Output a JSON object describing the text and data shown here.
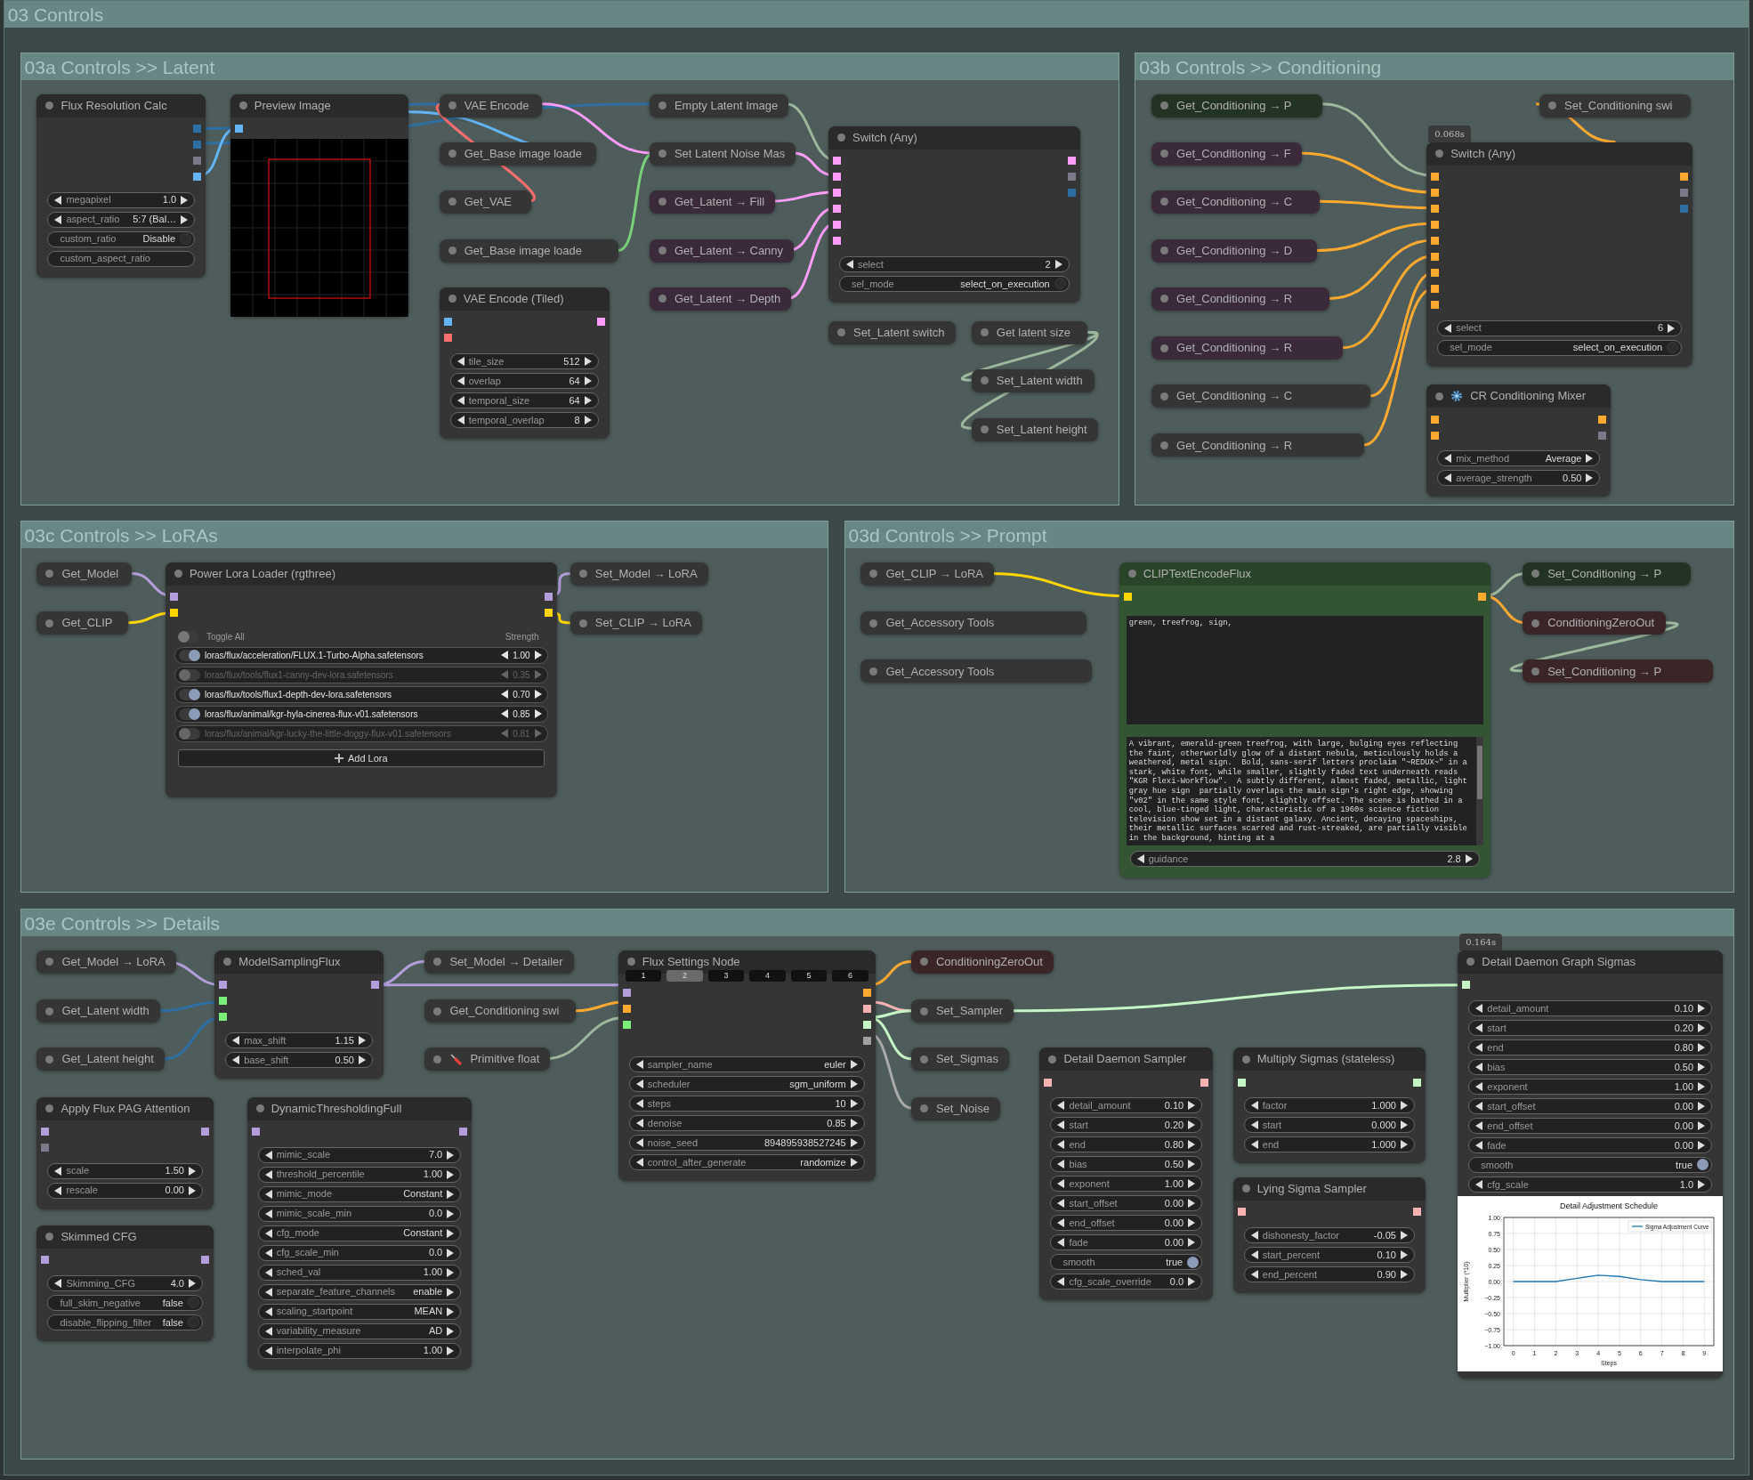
{
  "canvas": {
    "title": "03 Controls"
  },
  "groups": [
    {
      "title": "03a Controls >> Latent",
      "nodes": [
        {
          "title": "Flux Resolution Calc",
          "kind": "node",
          "color": "#353535",
          "outputs": [
            {
              "color": "#2d6ea3"
            },
            {
              "color": "#2d6ea3"
            },
            {
              "color": "#7a7a8a"
            },
            {
              "color": "#64b5f6"
            }
          ],
          "widgets": [
            {
              "kind": "number",
              "label": "megapixel",
              "value": "1.0"
            },
            {
              "kind": "number",
              "label": "aspect_ratio",
              "value": "5:7 (Bal…"
            },
            {
              "kind": "toggle",
              "label": "custom_ratio",
              "value": "Disable",
              "on": false
            },
            {
              "kind": "text",
              "label": "custom_aspect_ratio"
            }
          ]
        },
        {
          "title": "Preview Image",
          "kind": "preview",
          "color": "#353535",
          "inputs": [
            {
              "color": "#64b5f6"
            }
          ]
        },
        {
          "title": "VAE Encode",
          "kind": "collapsed",
          "color": "#353535"
        },
        {
          "title": "Get_Base image loade",
          "kind": "collapsed",
          "color": "#353535"
        },
        {
          "title": "Get_VAE",
          "kind": "collapsed",
          "color": "#353535"
        },
        {
          "title": "Get_Base image loade",
          "kind": "collapsed",
          "color": "#353535"
        },
        {
          "title": "VAE Encode (Tiled)",
          "kind": "node",
          "color": "#353535",
          "inputs": [
            {
              "color": "#64b5f6"
            },
            {
              "color": "#ff6e6e"
            }
          ],
          "outputs": [
            {
              "color": "#ff9cf9"
            }
          ],
          "widgets": [
            {
              "kind": "number",
              "label": "tile_size",
              "value": "512"
            },
            {
              "kind": "number",
              "label": "overlap",
              "value": "64"
            },
            {
              "kind": "number",
              "label": "temporal_size",
              "value": "64"
            },
            {
              "kind": "number",
              "label": "temporal_overlap",
              "value": "8"
            }
          ]
        },
        {
          "title": "Empty Latent Image",
          "kind": "collapsed",
          "color": "#353535"
        },
        {
          "title": "Set Latent Noise Mas",
          "kind": "collapsed",
          "color": "#353535"
        },
        {
          "title": "Get_Latent → Fill",
          "kind": "collapsed",
          "color": "#3a2a3a"
        },
        {
          "title": "Get_Latent → Canny",
          "kind": "collapsed",
          "color": "#3a2a3a"
        },
        {
          "title": "Get_Latent → Depth",
          "kind": "collapsed",
          "color": "#3a2a3a"
        },
        {
          "title": "Switch (Any)",
          "kind": "node",
          "color": "#353535",
          "inputs": [
            {
              "color": "#ff9cf9"
            },
            {
              "color": "#ff9cf9"
            },
            {
              "color": "#ff9cf9"
            },
            {
              "color": "#ff9cf9"
            },
            {
              "color": "#ff9cf9"
            },
            {
              "color": "#ff9cf9"
            }
          ],
          "outputs": [
            {
              "color": "#ff9cf9"
            },
            {
              "color": "#7a7a8a"
            },
            {
              "color": "#2d6ea3"
            }
          ],
          "widgets": [
            {
              "kind": "number",
              "label": "select",
              "value": "2"
            },
            {
              "kind": "toggle",
              "label": "sel_mode",
              "value": "select_on_execution",
              "on": false
            }
          ]
        },
        {
          "title": "Set_Latent switch",
          "kind": "collapsed",
          "color": "#353535"
        },
        {
          "title": "Get latent size",
          "kind": "collapsed",
          "color": "#353535"
        },
        {
          "title": "Set_Latent width",
          "kind": "collapsed",
          "color": "#353535"
        },
        {
          "title": "Set_Latent height",
          "kind": "collapsed",
          "color": "#353535"
        }
      ]
    },
    {
      "title": "03b Controls >> Conditioning",
      "nodes": [
        {
          "title": "Get_Conditioning → P",
          "kind": "collapsed",
          "color": "#233323"
        },
        {
          "title": "Get_Conditioning → F",
          "kind": "collapsed",
          "color": "#3a2a3a"
        },
        {
          "title": "Get_Conditioning → C",
          "kind": "collapsed",
          "color": "#3a2a3a"
        },
        {
          "title": "Get_Conditioning → D",
          "kind": "collapsed",
          "color": "#3a2a3a"
        },
        {
          "title": "Get_Conditioning → R",
          "kind": "collapsed",
          "color": "#3a2a3a"
        },
        {
          "title": "Get_Conditioning → R",
          "kind": "collapsed",
          "color": "#3a2a3a"
        },
        {
          "title": "Get_Conditioning → C",
          "kind": "collapsed",
          "color": "#353535"
        },
        {
          "title": "Get_Conditioning → R",
          "kind": "collapsed",
          "color": "#353535"
        },
        {
          "title": "Set_Conditioning swi",
          "kind": "collapsed",
          "color": "#353535"
        },
        {
          "title": "Switch (Any)",
          "kind": "node",
          "color": "#353535",
          "badge": "0.068s",
          "inputs": [
            {
              "color": "#ffa931"
            },
            {
              "color": "#ffa931"
            },
            {
              "color": "#ffa931"
            },
            {
              "color": "#ffa931"
            },
            {
              "color": "#ffa931"
            },
            {
              "color": "#ffa931"
            },
            {
              "color": "#ffa931"
            },
            {
              "color": "#ffa931"
            },
            {
              "color": "#ffa931"
            }
          ],
          "outputs": [
            {
              "color": "#ffa931"
            },
            {
              "color": "#7a7a8a"
            },
            {
              "color": "#2d6ea3"
            }
          ],
          "widgets": [
            {
              "kind": "number",
              "label": "select",
              "value": "6"
            },
            {
              "kind": "toggle",
              "label": "sel_mode",
              "value": "select_on_execution",
              "on": false
            }
          ]
        },
        {
          "title": "CR Conditioning Mixer",
          "kind": "node",
          "color": "#353535",
          "inputs": [
            {
              "color": "#ffa931"
            },
            {
              "color": "#ffa931"
            }
          ],
          "outputs": [
            {
              "color": "#ffa931"
            },
            {
              "color": "#7a7a8a"
            }
          ],
          "widgets": [
            {
              "kind": "number",
              "label": "mix_method",
              "value": "Average"
            },
            {
              "kind": "number",
              "label": "average_strength",
              "value": "0.50"
            }
          ]
        }
      ]
    },
    {
      "title": "03c Controls >> LoRAs",
      "nodes": [
        {
          "title": "Get_Model",
          "kind": "collapsed",
          "color": "#353535"
        },
        {
          "title": "Get_CLIP",
          "kind": "collapsed",
          "color": "#353535"
        },
        {
          "title": "Power Lora Loader (rgthree)",
          "kind": "node",
          "color": "#353535",
          "inputs": [
            {
              "color": "#b39ddb"
            },
            {
              "color": "#ffd500"
            }
          ],
          "outputs": [
            {
              "color": "#b39ddb"
            },
            {
              "color": "#ffd500"
            }
          ],
          "toggle_all": {
            "label": "Toggle All",
            "on": false
          },
          "strength_label": "Strength",
          "loras": [
            {
              "name": "loras/flux/acceleration/FLUX.1-Turbo-Alpha.safetensors",
              "strength": "1.00",
              "on": true
            },
            {
              "name": "loras/flux/tools/flux1-canny-dev-lora.safetensors",
              "strength": "0.35",
              "on": false
            },
            {
              "name": "loras/flux/tools/flux1-depth-dev-lora.safetensors",
              "strength": "0.70",
              "on": true
            },
            {
              "name": "loras/flux/animal/kgr-hyla-cinerea-flux-v01.safetensors",
              "strength": "0.85",
              "on": true
            },
            {
              "name": "loras/flux/animal/kgr-lucky-the-little-doggy-flux-v01.safetensors",
              "strength": "0.81",
              "on": false
            }
          ],
          "add_button": "Add Lora"
        },
        {
          "title": "Set_Model → LoRA",
          "kind": "collapsed",
          "color": "#353535"
        },
        {
          "title": "Set_CLIP → LoRA",
          "kind": "collapsed",
          "color": "#353535"
        }
      ]
    },
    {
      "title": "03d Controls >> Prompt",
      "nodes": [
        {
          "title": "Get_CLIP → LoRA",
          "kind": "collapsed",
          "color": "#353535"
        },
        {
          "title": "Get_Accessory Tools",
          "kind": "collapsed",
          "color": "#353535"
        },
        {
          "title": "Get_Accessory Tools",
          "kind": "collapsed",
          "color": "#353535"
        },
        {
          "title": "CLIPTextEncodeFlux",
          "kind": "node",
          "color": "#335533",
          "inputs": [
            {
              "color": "#ffd500"
            }
          ],
          "outputs": [
            {
              "color": "#ffa931"
            }
          ],
          "textareas": [
            "green, treefrog, sign,",
            "A vibrant, emerald-green treefrog, with large, bulging eyes reflecting the faint, otherworldly glow of a distant nebula, meticulously holds a weathered, metal sign.  Bold, sans-serif letters proclaim \"~REDUX~\" in a stark, white font, while smaller, slightly faded text underneath reads \"KGR Flexi-Workflow\".  A subtly different, almost faded, metallic, light gray hue sign  partially overlaps the main sign's right edge, showing \"v02\" in the same style font, slightly offset. The scene is bathed in a cool, blue-tinged light, characteristic of a 1960s science fiction television show set in a distant galaxy. Ancient, decaying spaceships, their metallic surfaces scarred and rust-streaked, are partially visible in the background, hinting at a"
          ],
          "widgets": [
            {
              "kind": "number",
              "label": "guidance",
              "value": "2.8"
            }
          ]
        },
        {
          "title": "Set_Conditioning → P",
          "kind": "collapsed",
          "color": "#233323"
        },
        {
          "title": "ConditioningZeroOut",
          "kind": "collapsed",
          "color": "#3a2626"
        },
        {
          "title": "Set_Conditioning → P",
          "kind": "collapsed",
          "color": "#3a2626"
        }
      ]
    },
    {
      "title": "03e Controls >> Details",
      "nodes": [
        {
          "title": "Get_Model → LoRA",
          "kind": "collapsed",
          "color": "#353535"
        },
        {
          "title": "ModelSamplingFlux",
          "kind": "node",
          "color": "#353535",
          "inputs": [
            {
              "color": "#b39ddb"
            },
            {
              "color": "#7bed7b"
            },
            {
              "color": "#7bed7b"
            }
          ],
          "outputs": [
            {
              "color": "#b39ddb"
            }
          ],
          "widgets": [
            {
              "kind": "number",
              "label": "max_shift",
              "value": "1.15"
            },
            {
              "kind": "number",
              "label": "base_shift",
              "value": "0.50"
            }
          ]
        },
        {
          "title": "Set_Model → Detailer",
          "kind": "collapsed",
          "color": "#353535"
        },
        {
          "title": "Flux Settings Node",
          "kind": "node",
          "color": "#353535",
          "tabs": [
            {
              "label": "1",
              "selected": false
            },
            {
              "label": "2",
              "selected": true
            },
            {
              "label": "3",
              "selected": false
            },
            {
              "label": "4",
              "selected": false
            },
            {
              "label": "5",
              "selected": false
            },
            {
              "label": "6",
              "selected": false
            }
          ],
          "inputs": [
            {
              "color": "#b39ddb"
            },
            {
              "color": "#ffa931"
            },
            {
              "color": "#7bed7b"
            }
          ],
          "outputs": [
            {
              "color": "#ffa931"
            },
            {
              "color": "#f5b2b2"
            },
            {
              "color": "#c5f5c5"
            },
            {
              "color": "#a0a0a0"
            }
          ],
          "widgets": [
            {
              "kind": "number",
              "label": "sampler_name",
              "value": "euler"
            },
            {
              "kind": "number",
              "label": "scheduler",
              "value": "sgm_uniform"
            },
            {
              "kind": "number",
              "label": "steps",
              "value": "10"
            },
            {
              "kind": "number",
              "label": "denoise",
              "value": "0.85"
            },
            {
              "kind": "number",
              "label": "noise_seed",
              "value": "894895938527245"
            },
            {
              "kind": "number",
              "label": "control_after_generate",
              "value": "randomize"
            }
          ]
        },
        {
          "title": "ConditioningZeroOut",
          "kind": "collapsed",
          "color": "#3a2626"
        },
        {
          "title": "Detail Daemon Graph Sigmas",
          "kind": "node",
          "color": "#353535",
          "badge": "0.164s",
          "inputs": [
            {
              "color": "#c5f5c5"
            }
          ],
          "widgets": [
            {
              "kind": "number",
              "label": "detail_amount",
              "value": "0.10"
            },
            {
              "kind": "number",
              "label": "start",
              "value": "0.20"
            },
            {
              "kind": "number",
              "label": "end",
              "value": "0.80"
            },
            {
              "kind": "number",
              "label": "bias",
              "value": "0.50"
            },
            {
              "kind": "number",
              "label": "exponent",
              "value": "1.00"
            },
            {
              "kind": "number",
              "label": "start_offset",
              "value": "0.00"
            },
            {
              "kind": "number",
              "label": "end_offset",
              "value": "0.00"
            },
            {
              "kind": "number",
              "label": "fade",
              "value": "0.00"
            },
            {
              "kind": "toggle",
              "label": "smooth",
              "value": "true",
              "on": true
            },
            {
              "kind": "number",
              "label": "cfg_scale",
              "value": "1.0"
            }
          ],
          "chart_data": {
            "type": "line",
            "title": "Detail Adjustment Schedule",
            "xlabel": "Steps",
            "ylabel": "Multiplier (*10)",
            "x": [
              0,
              1,
              2,
              3,
              4,
              5,
              6,
              7,
              8,
              9
            ],
            "series": [
              {
                "name": "Sigma Adjustment Curve",
                "color": "#1f77b4",
                "values": [
                  0,
                  0,
                  0,
                  0.05,
                  0.1,
                  0.08,
                  0.03,
                  0,
                  0,
                  0
                ]
              }
            ],
            "xlim": [
              -0.45,
              9.45
            ],
            "ylim": [
              -1,
              1
            ],
            "grid": true,
            "xticks": [
              0,
              1,
              2,
              3,
              4,
              5,
              6,
              7,
              8,
              9
            ],
            "yticks": [
              {
                "value": 1,
                "label": "1.00"
              },
              {
                "value": 0.75,
                "label": "0.75"
              },
              {
                "value": 0.5,
                "label": "0.50"
              },
              {
                "value": 0.25,
                "label": "0.25"
              },
              {
                "value": 0,
                "label": "0.00"
              },
              {
                "value": -0.25,
                "label": "−0.25"
              },
              {
                "value": -0.5,
                "label": "−0.50"
              },
              {
                "value": -0.75,
                "label": "−0.75"
              },
              {
                "value": -1,
                "label": "−1.00"
              }
            ]
          }
        },
        {
          "title": "Get_Latent width",
          "kind": "collapsed",
          "color": "#353535"
        },
        {
          "title": "Get_Conditioning swi",
          "kind": "collapsed",
          "color": "#353535"
        },
        {
          "title": "Set_Sampler",
          "kind": "collapsed",
          "color": "#353535"
        },
        {
          "title": "Get_Latent height",
          "kind": "collapsed",
          "color": "#353535"
        },
        {
          "title": "Primitive float",
          "kind": "collapsed",
          "color": "#353535"
        },
        {
          "title": "Set_Sigmas",
          "kind": "collapsed",
          "color": "#353535"
        },
        {
          "title": "Detail Daemon Sampler",
          "kind": "node",
          "color": "#353535",
          "inputs": [
            {
              "color": "#f5b2b2"
            }
          ],
          "outputs": [
            {
              "color": "#f5b2b2"
            }
          ],
          "widgets": [
            {
              "kind": "number",
              "label": "detail_amount",
              "value": "0.10"
            },
            {
              "kind": "number",
              "label": "start",
              "value": "0.20"
            },
            {
              "kind": "number",
              "label": "end",
              "value": "0.80"
            },
            {
              "kind": "number",
              "label": "bias",
              "value": "0.50"
            },
            {
              "kind": "number",
              "label": "exponent",
              "value": "1.00"
            },
            {
              "kind": "number",
              "label": "start_offset",
              "value": "0.00"
            },
            {
              "kind": "number",
              "label": "end_offset",
              "value": "0.00"
            },
            {
              "kind": "number",
              "label": "fade",
              "value": "0.00"
            },
            {
              "kind": "toggle",
              "label": "smooth",
              "value": "true",
              "on": true
            },
            {
              "kind": "number",
              "label": "cfg_scale_override",
              "value": "0.0"
            }
          ]
        },
        {
          "title": "Multiply Sigmas (stateless)",
          "kind": "node",
          "color": "#353535",
          "inputs": [
            {
              "color": "#c5f5c5"
            }
          ],
          "outputs": [
            {
              "color": "#c5f5c5"
            }
          ],
          "widgets": [
            {
              "kind": "number",
              "label": "factor",
              "value": "1.000"
            },
            {
              "kind": "number",
              "label": "start",
              "value": "0.000"
            },
            {
              "kind": "number",
              "label": "end",
              "value": "1.000"
            }
          ]
        },
        {
          "title": "Apply Flux PAG Attention",
          "kind": "node",
          "color": "#353535",
          "inputs": [
            {
              "color": "#b39ddb"
            },
            {
              "color": "#7a7a8a"
            }
          ],
          "outputs": [
            {
              "color": "#b39ddb"
            }
          ],
          "widgets": [
            {
              "kind": "number",
              "label": "scale",
              "value": "1.50"
            },
            {
              "kind": "number",
              "label": "rescale",
              "value": "0.00"
            }
          ]
        },
        {
          "title": "DynamicThresholdingFull",
          "kind": "node",
          "color": "#353535",
          "inputs": [
            {
              "color": "#b39ddb"
            }
          ],
          "outputs": [
            {
              "color": "#b39ddb"
            }
          ],
          "widgets": [
            {
              "kind": "number",
              "label": "mimic_scale",
              "value": "7.0"
            },
            {
              "kind": "number",
              "label": "threshold_percentile",
              "value": "1.00"
            },
            {
              "kind": "number",
              "label": "mimic_mode",
              "value": "Constant"
            },
            {
              "kind": "number",
              "label": "mimic_scale_min",
              "value": "0.0"
            },
            {
              "kind": "number",
              "label": "cfg_mode",
              "value": "Constant"
            },
            {
              "kind": "number",
              "label": "cfg_scale_min",
              "value": "0.0"
            },
            {
              "kind": "number",
              "label": "sched_val",
              "value": "1.00"
            },
            {
              "kind": "number",
              "label": "separate_feature_channels",
              "value": "enable"
            },
            {
              "kind": "number",
              "label": "scaling_startpoint",
              "value": "MEAN"
            },
            {
              "kind": "number",
              "label": "variability_measure",
              "value": "AD"
            },
            {
              "kind": "number",
              "label": "interpolate_phi",
              "value": "1.00"
            }
          ]
        },
        {
          "title": "Set_Noise",
          "kind": "collapsed",
          "color": "#353535"
        },
        {
          "title": "Lying Sigma Sampler",
          "kind": "node",
          "color": "#353535",
          "inputs": [
            {
              "color": "#f5b2b2"
            }
          ],
          "outputs": [
            {
              "color": "#f5b2b2"
            }
          ],
          "widgets": [
            {
              "kind": "number",
              "label": "dishonesty_factor",
              "value": "-0.05"
            },
            {
              "kind": "number",
              "label": "start_percent",
              "value": "0.10"
            },
            {
              "kind": "number",
              "label": "end_percent",
              "value": "0.90"
            }
          ]
        },
        {
          "title": "Skimmed CFG",
          "kind": "node",
          "color": "#353535",
          "inputs": [
            {
              "color": "#b39ddb"
            }
          ],
          "outputs": [
            {
              "color": "#b39ddb"
            }
          ],
          "widgets": [
            {
              "kind": "number",
              "label": "Skimming_CFG",
              "value": "4.0"
            },
            {
              "kind": "toggle",
              "label": "full_skim_negative",
              "value": "false",
              "on": false
            },
            {
              "kind": "toggle",
              "label": "disable_flipping_filter",
              "value": "false",
              "on": false
            }
          ]
        }
      ]
    }
  ]
}
